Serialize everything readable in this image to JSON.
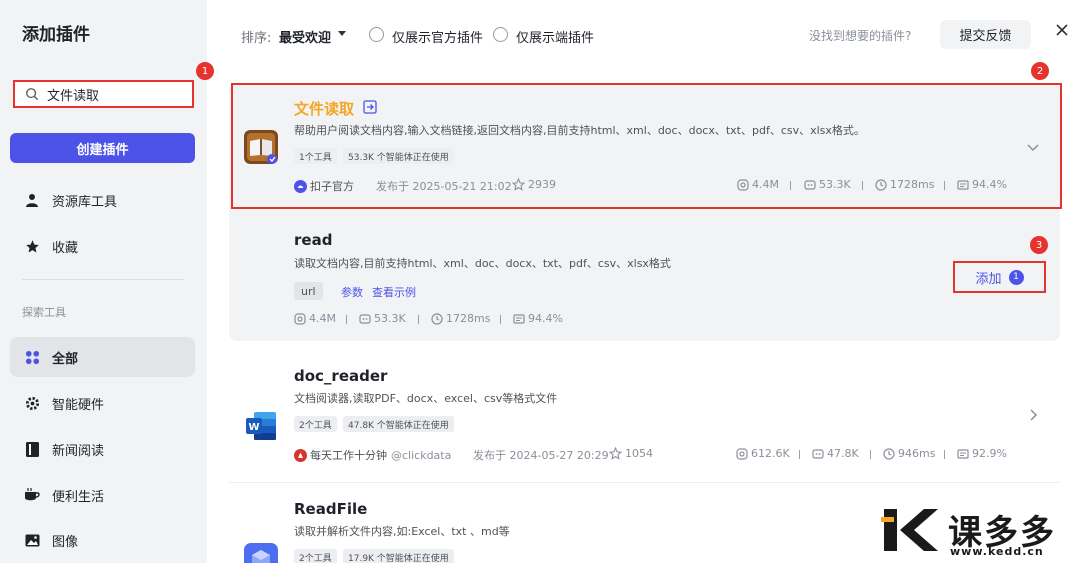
{
  "sidebar": {
    "title": "添加插件",
    "search_value": "文件读取",
    "create_label": "创建插件",
    "items_top": [
      {
        "label": "资源库工具",
        "icon": "person-icon"
      },
      {
        "label": "收藏",
        "icon": "star-icon"
      }
    ],
    "section_label": "探索工具",
    "items_explore": [
      {
        "label": "全部",
        "icon": "grid-icon"
      },
      {
        "label": "智能硬件",
        "icon": "gear-icon"
      },
      {
        "label": "新闻阅读",
        "icon": "book-icon"
      },
      {
        "label": "便利生活",
        "icon": "cup-icon"
      },
      {
        "label": "图像",
        "icon": "image-icon"
      }
    ]
  },
  "badges": {
    "b1": "1",
    "b2": "2",
    "b3": "3"
  },
  "topbar": {
    "sort_label": "排序:",
    "sort_value": "最受欢迎",
    "official_only": "仅展示官方插件",
    "client_only": "仅展示端插件",
    "not_found": "没找到想要的插件?",
    "feedback": "提交反馈"
  },
  "plugins": [
    {
      "name": "文件读取",
      "desc": "帮助用户阅读文档内容,输入文档链接,返回文档内容,目前支持html、xml、doc、docx、txt、pdf、csv、xlsx格式。",
      "tools": "1个工具",
      "users": "53.3K 个智能体正在使用",
      "author": "扣子官方",
      "published": "发布于 2025-05-21 21:02",
      "favorites": "2939",
      "calls": "4.4M",
      "bots": "53.3K",
      "latency": "1728ms",
      "success": "94.4%"
    },
    {
      "name": "doc_reader",
      "desc": "文档阅读器,读取PDF、docx、excel、csv等格式文件",
      "tools": "2个工具",
      "users": "47.8K 个智能体正在使用",
      "author": "每天工作十分钟",
      "handle": "@clickdata",
      "published": "发布于 2024-05-27 20:29",
      "favorites": "1054",
      "calls": "612.6K",
      "bots": "47.8K",
      "latency": "946ms",
      "success": "92.9%"
    },
    {
      "name": "ReadFile",
      "desc": "读取并解析文件内容,如:Excel、txt 、md等",
      "tools": "2个工具",
      "users": "17.9K 个智能体正在使用"
    }
  ],
  "tool": {
    "name": "read",
    "desc": "读取文档内容,目前支持html、xml、doc、docx、txt、pdf、csv、xlsx格式",
    "param": "url",
    "params_link": "参数",
    "example_link": "查看示例",
    "calls": "4.4M",
    "bots": "53.3K",
    "latency": "1728ms",
    "success": "94.4%",
    "add_label": "添加",
    "add_count": "1"
  },
  "watermark": {
    "brand": "课多多",
    "url": "www.kedd.cn"
  },
  "colors": {
    "accent": "#4d53e8",
    "highlight": "#e5332d",
    "title_orange": "#f5a623"
  }
}
